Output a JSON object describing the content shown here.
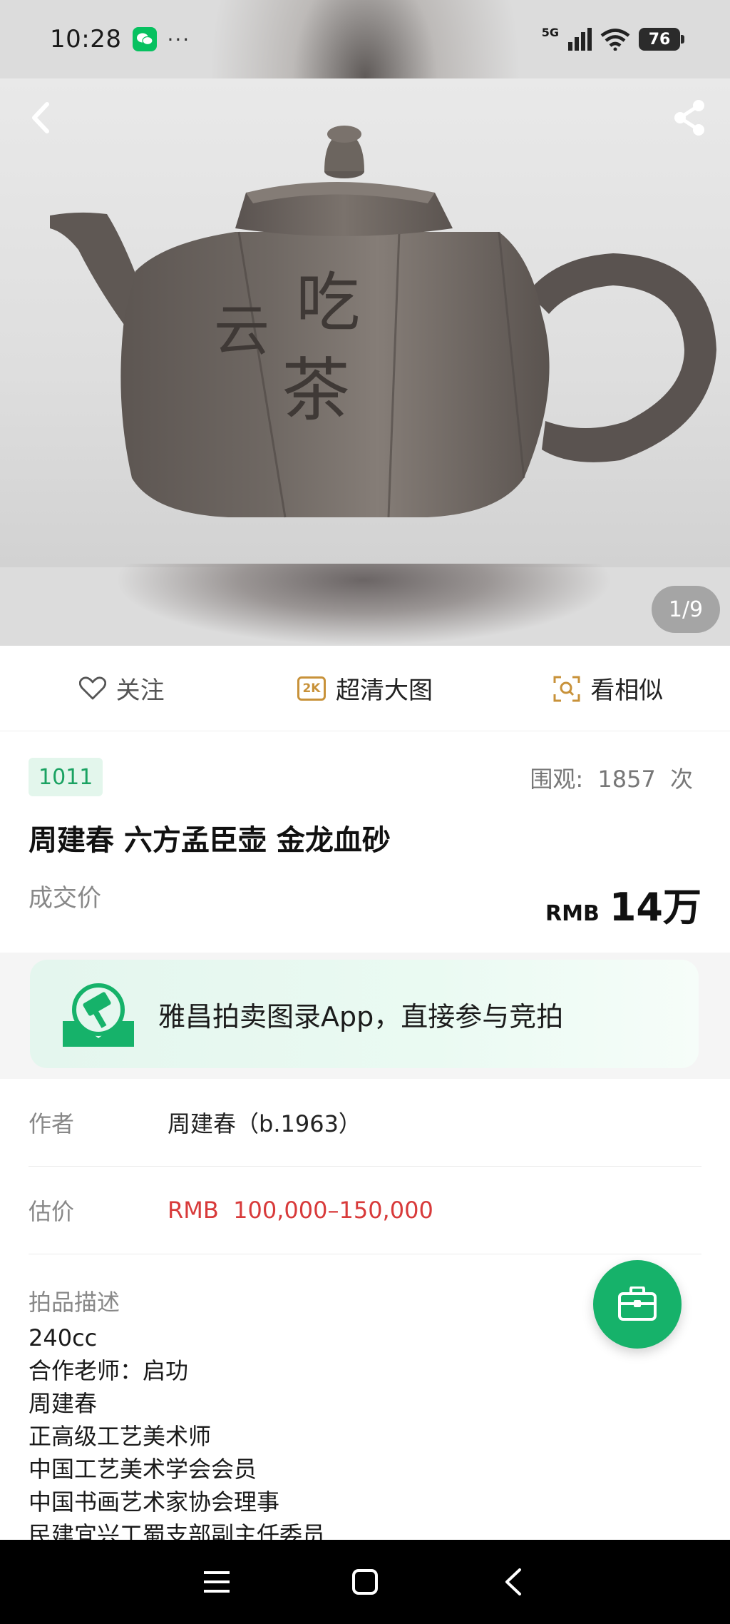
{
  "status_bar": {
    "time": "10:28",
    "dots": "···",
    "network": "5G",
    "battery": "76"
  },
  "hero": {
    "counter": "1/9",
    "icons": {
      "back": "chevron-left-icon",
      "share": "share-icon"
    },
    "inscription": [
      "云",
      "吃",
      "茶"
    ]
  },
  "actions": [
    {
      "label": "关注",
      "icon": "heart-outline-icon"
    },
    {
      "label": "超清大图",
      "icon": "2k-icon",
      "badge": "2K"
    },
    {
      "label": "看相似",
      "icon": "image-search-icon"
    }
  ],
  "lot": {
    "number": "1011",
    "views_label": "围观:",
    "views_count": "1857",
    "views_unit": "次",
    "title": "周建春 六方孟臣壶 金龙血砂",
    "price_label": "成交价",
    "price_currency": "RMB",
    "price_value": "14万"
  },
  "promo": {
    "text": "雅昌拍卖图录App，直接参与竞拍",
    "logo": "auction-gavel-logo"
  },
  "details": {
    "author_label": "作者",
    "author_value": "周建春（b.1963）",
    "estimate_label": "估价",
    "estimate_value": "RMB  100,000–150,000"
  },
  "description": {
    "title": "拍品描述",
    "lines": [
      "240cc",
      "合作老师：启功",
      "周建春",
      "正高级工艺美术师",
      "中国工艺美术学会会员",
      "中国书画艺术家协会理事",
      "民建宜兴工蜀支部副主任委员"
    ]
  },
  "fab": {
    "icon": "briefcase-icon"
  },
  "colors": {
    "accent_green": "#16b26a",
    "badge_green": "#1aa262",
    "estimate_red": "#d83a3a",
    "hd_icon_orange": "#c8923a"
  },
  "navbar": {
    "icons": [
      "menu-icon",
      "home-icon",
      "back-icon"
    ]
  }
}
